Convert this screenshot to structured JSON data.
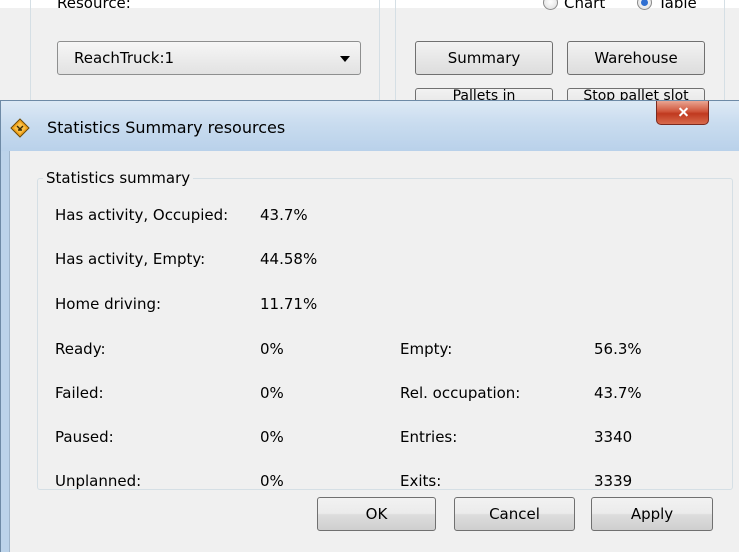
{
  "background_window": {
    "resource_label": "Resource:",
    "resource_value": "ReachTruck:1",
    "radio_chart_label": "Chart",
    "radio_table_label": "Table",
    "summary_label": "Summary",
    "warehouse_label": "Warehouse",
    "pallets_label": "Pallets in",
    "stop_label": "Stop pallet slot"
  },
  "dialog": {
    "title": "Statistics Summary resources",
    "group_title": "Statistics summary",
    "top_stats": [
      {
        "label": "Has activity, Occupied:",
        "value": "43.7%"
      },
      {
        "label": "Has activity, Empty:",
        "value": "44.58%"
      },
      {
        "label": "Home driving:",
        "value": "11.71%"
      }
    ],
    "left_stats": [
      {
        "label": "Ready:",
        "value": "0%"
      },
      {
        "label": "Failed:",
        "value": "0%"
      },
      {
        "label": "Paused:",
        "value": "0%"
      },
      {
        "label": "Unplanned:",
        "value": "0%"
      }
    ],
    "right_stats": [
      {
        "label": "Empty:",
        "value": "56.3%"
      },
      {
        "label": "Rel. occupation:",
        "value": "43.7%"
      },
      {
        "label": "Entries:",
        "value": "3340"
      },
      {
        "label": "Exits:",
        "value": "3339"
      }
    ],
    "buttons": {
      "ok": "OK",
      "cancel": "Cancel",
      "apply": "Apply"
    }
  },
  "icons": {
    "title_icon": "warning-diamond-icon",
    "close_icon": "close-icon",
    "combo_arrow": "chevron-down-icon"
  },
  "colors": {
    "titlebar": "#c9dcef",
    "close_button": "#c0391f",
    "client_bg": "#f0f0f0",
    "icon_orange": "#f2a31b"
  }
}
